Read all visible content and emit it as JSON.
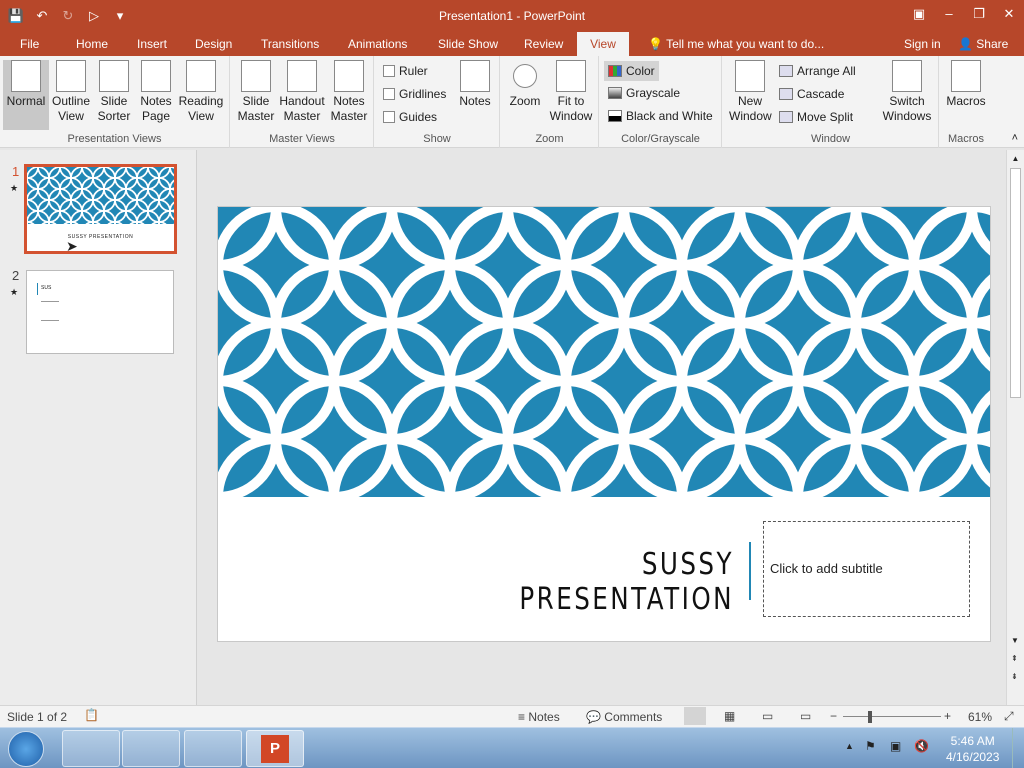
{
  "window": {
    "title": "Presentation1 - PowerPoint"
  },
  "tabs": [
    "File",
    "Home",
    "Insert",
    "Design",
    "Transitions",
    "Animations",
    "Slide Show",
    "Review",
    "View"
  ],
  "tell_me": "Tell me what you want to do...",
  "signin": "Sign in",
  "share": "Share",
  "ribbon": {
    "presentation_views": {
      "label": "Presentation Views",
      "buttons": [
        "Normal",
        "Outline\nView",
        "Slide\nSorter",
        "Notes\nPage",
        "Reading\nView"
      ]
    },
    "master_views": {
      "label": "Master Views",
      "buttons": [
        "Slide\nMaster",
        "Handout\nMaster",
        "Notes\nMaster"
      ]
    },
    "show": {
      "label": "Show",
      "checkboxes": [
        "Ruler",
        "Gridlines",
        "Guides"
      ],
      "notes": "Notes"
    },
    "zoom": {
      "label": "Zoom",
      "zoom": "Zoom",
      "fit": "Fit to\nWindow"
    },
    "color": {
      "label": "Color/Grayscale",
      "items": [
        "Color",
        "Grayscale",
        "Black and White"
      ]
    },
    "window": {
      "label": "Window",
      "new_window": "New\nWindow",
      "arrange_all": "Arrange All",
      "cascade": "Cascade",
      "move_split": "Move Split",
      "switch": "Switch\nWindows"
    },
    "macros": {
      "label": "Macros",
      "macros": "Macros"
    }
  },
  "slides": [
    {
      "num": "1",
      "title": "SUSSY PRESENTATION"
    },
    {
      "num": "2",
      "title": "SUS"
    }
  ],
  "slide": {
    "title": "SUSSY PRESENTATION",
    "subtitle_placeholder": "Click to add subtitle"
  },
  "status": {
    "slide": "Slide 1 of 2",
    "notes": "Notes",
    "comments": "Comments",
    "zoom": "61%"
  },
  "clock": {
    "time": "5:46 AM",
    "date": "4/16/2023"
  },
  "colors": {
    "brand": "#b7472a",
    "pattern": "#2187b5"
  }
}
